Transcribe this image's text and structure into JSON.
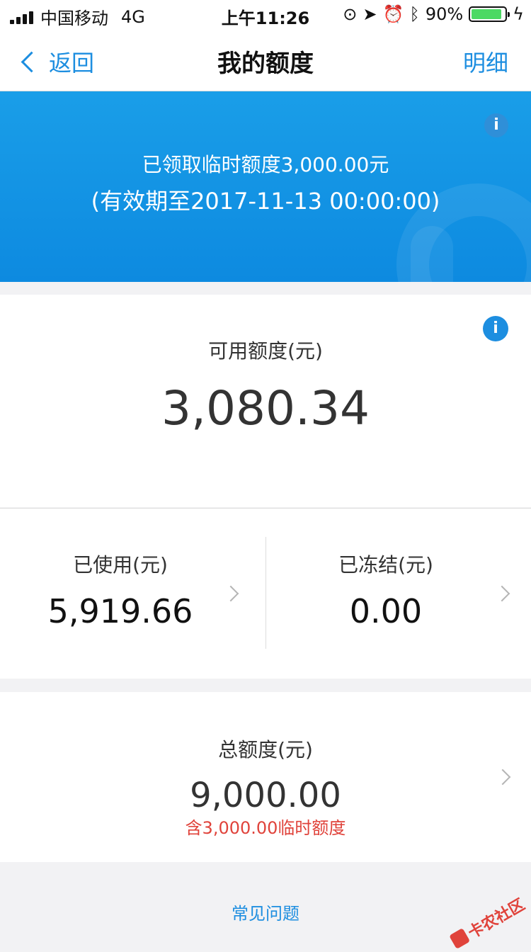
{
  "status_bar": {
    "carrier": "中国移动",
    "network": "4G",
    "time": "上午11:26",
    "battery_percent": "90%",
    "battery_level": 0.9
  },
  "nav": {
    "back_label": "返回",
    "title": "我的额度",
    "detail_label": "明细"
  },
  "banner": {
    "line1": "已领取临时额度3,000.00元",
    "line2": "(有效期至2017-11-13 00:00:00)",
    "info_icon": "i"
  },
  "available": {
    "label": "可用额度(元)",
    "value": "3,080.34",
    "info_icon": "i"
  },
  "used": {
    "label": "已使用(元)",
    "value": "5,919.66"
  },
  "frozen": {
    "label": "已冻结(元)",
    "value": "0.00"
  },
  "total": {
    "label": "总额度(元)",
    "value": "9,000.00",
    "note": "含3,000.00临时额度"
  },
  "faq": {
    "label": "常见问题"
  },
  "watermark": {
    "text": "卡农社区"
  },
  "colors": {
    "accent": "#1d8ee0",
    "banner": "#1a9ee8",
    "warning": "#e0433b"
  }
}
